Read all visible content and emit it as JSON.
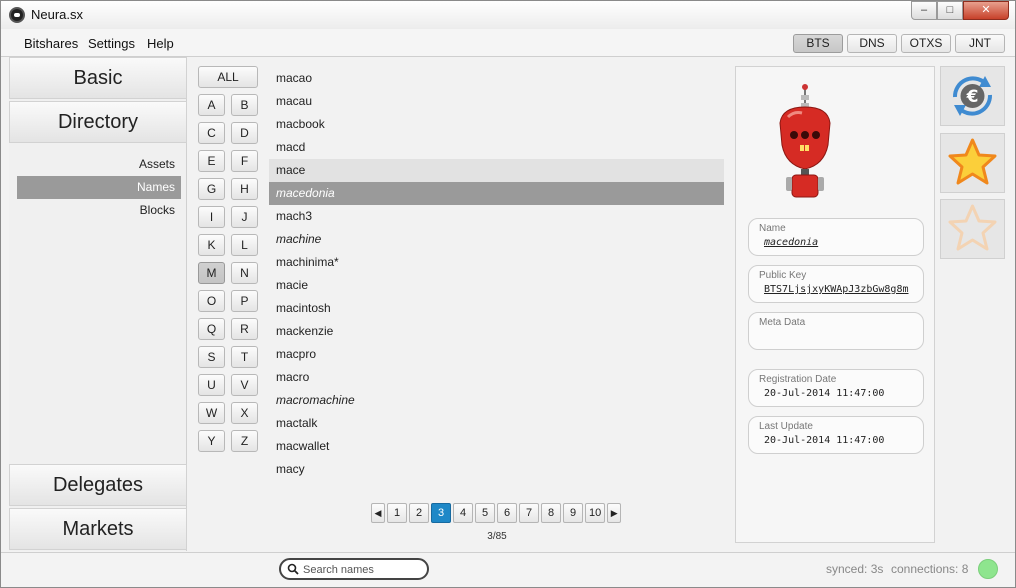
{
  "window": {
    "title": "Neura.sx",
    "minimize": "–",
    "maximize": "□",
    "close": "✕"
  },
  "menu": {
    "items": [
      "Bitshares",
      "Settings",
      "Help"
    ]
  },
  "chains": {
    "tabs": [
      "BTS",
      "DNS",
      "OTXS",
      "JNT"
    ],
    "active": "BTS"
  },
  "nav": {
    "basic": "Basic",
    "directory": "Directory",
    "subitems": [
      "Assets",
      "Names",
      "Blocks"
    ],
    "active_subitem": "Names",
    "delegates": "Delegates",
    "markets": "Markets"
  },
  "letters": {
    "all": "ALL",
    "items": [
      "A",
      "B",
      "C",
      "D",
      "E",
      "F",
      "G",
      "H",
      "I",
      "J",
      "K",
      "L",
      "M",
      "N",
      "O",
      "P",
      "Q",
      "R",
      "S",
      "T",
      "U",
      "V",
      "W",
      "X",
      "Y",
      "Z"
    ],
    "active": "M"
  },
  "names": [
    {
      "name": "macao",
      "italic": false
    },
    {
      "name": "macau",
      "italic": false
    },
    {
      "name": "macbook",
      "italic": false
    },
    {
      "name": "macd",
      "italic": false
    },
    {
      "name": "mace",
      "italic": false,
      "hover": true
    },
    {
      "name": "macedonia",
      "italic": true,
      "selected": true
    },
    {
      "name": "mach3",
      "italic": false
    },
    {
      "name": "machine",
      "italic": true
    },
    {
      "name": "machinima*",
      "italic": false
    },
    {
      "name": "macie",
      "italic": false
    },
    {
      "name": "macintosh",
      "italic": false
    },
    {
      "name": "mackenzie",
      "italic": false
    },
    {
      "name": "macpro",
      "italic": false
    },
    {
      "name": "macro",
      "italic": false
    },
    {
      "name": "macromachine",
      "italic": true
    },
    {
      "name": "mactalk",
      "italic": false
    },
    {
      "name": "macwallet",
      "italic": false
    },
    {
      "name": "macy",
      "italic": false
    }
  ],
  "pagination": {
    "pages": [
      "1",
      "2",
      "3",
      "4",
      "5",
      "6",
      "7",
      "8",
      "9",
      "10"
    ],
    "current": "3",
    "counter": "3/85",
    "prev": "◀",
    "next": "▶"
  },
  "detail": {
    "name_label": "Name",
    "name_value": "macedonia",
    "key_label": "Public Key",
    "key_value": "BTS7LjsjxyKWApJ3zbGw8g8m",
    "meta_label": "Meta Data",
    "meta_value": "",
    "reg_label": "Registration Date",
    "reg_value": "20-Jul-2014 11:47:00",
    "upd_label": "Last Update",
    "upd_value": "20-Jul-2014 11:47:00"
  },
  "actions": [
    "euro-exchange-icon",
    "favorite-star-icon",
    "unfavorite-star-icon"
  ],
  "status": {
    "search_placeholder": "Search names",
    "synced": "synced: 3s",
    "connections": "connections: 8",
    "indicator_color": "#8ee58e"
  },
  "colors": {
    "accent": "#1e88c7",
    "selection": "#9a9a9a"
  }
}
